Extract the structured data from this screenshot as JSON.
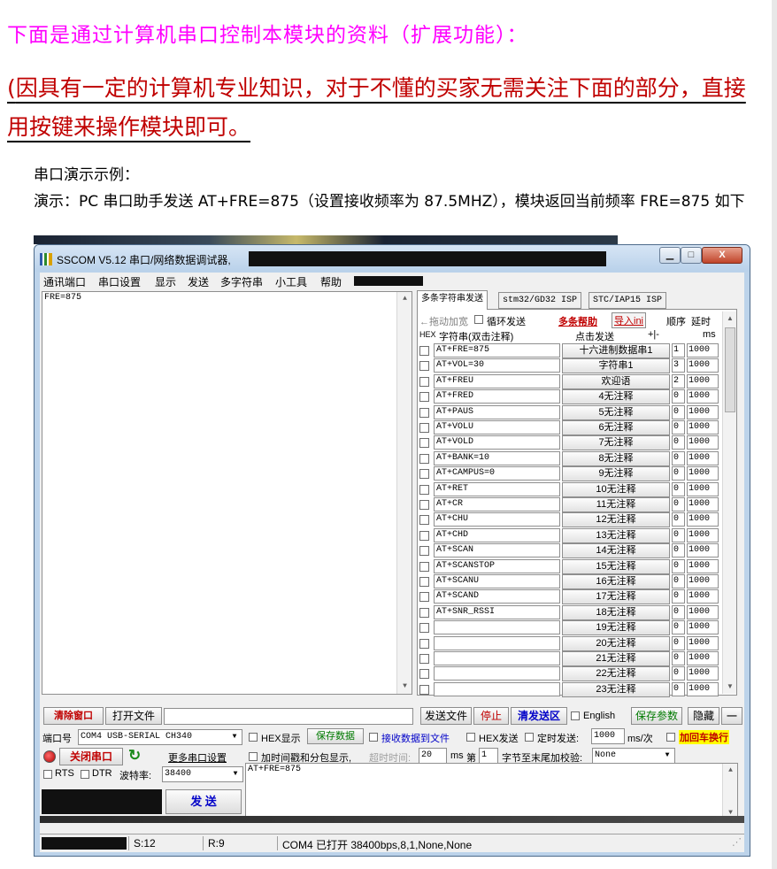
{
  "doc": {
    "heading": "下面是通过计算机串口控制本模块的资料（扩展功能）：",
    "note_open": "(",
    "note_text": "因具有一定的计算机专业知识，对于不懂的买家无需关注下面的部分，直接用按键来操作模块即可。",
    "demo_label": "串口演示示例：",
    "demo_line": "演示：PC 串口助手发送 AT+FRE=875（设置接收频率为 87.5MHZ），模块返回当前频率 FRE=875 如下"
  },
  "window": {
    "title": "SSCOM V5.12 串口/网络数据调试器,",
    "minimize": "▁",
    "maximize": "□",
    "close": "X"
  },
  "menu": [
    "通讯端口",
    "串口设置",
    "显示",
    "发送",
    "多字符串",
    "小工具",
    "帮助"
  ],
  "receive": {
    "text": "FRE=875"
  },
  "tabs": [
    "多条字符串发送",
    "stm32/GD32 ISP",
    "STC/IAP15 ISP"
  ],
  "panel": {
    "drag_hint": "←拖动加宽",
    "loop_send": "循环发送",
    "help": "多条帮助",
    "import": "导入ini",
    "order": "顺序",
    "delay": "延时",
    "hdr_hex": "HEX",
    "hdr_str": "字符串(双击注释)",
    "hdr_click": "点击发送",
    "hdr_pm": "+|-",
    "hdr_ms": "ms",
    "rows": [
      {
        "cmd": "AT+FRE=875",
        "label": "十六进制数据串1",
        "order": "1",
        "delay": "1000"
      },
      {
        "cmd": "AT+VOL=30",
        "label": "字符串1",
        "order": "3",
        "delay": "1000"
      },
      {
        "cmd": "AT+FREU",
        "label": "欢迎语",
        "order": "2",
        "delay": "1000"
      },
      {
        "cmd": "AT+FRED",
        "label": "4无注释",
        "order": "0",
        "delay": "1000"
      },
      {
        "cmd": "AT+PAUS",
        "label": "5无注释",
        "order": "0",
        "delay": "1000"
      },
      {
        "cmd": "AT+VOLU",
        "label": "6无注释",
        "order": "0",
        "delay": "1000"
      },
      {
        "cmd": "AT+VOLD",
        "label": "7无注释",
        "order": "0",
        "delay": "1000"
      },
      {
        "cmd": "AT+BANK=10",
        "label": "8无注释",
        "order": "0",
        "delay": "1000"
      },
      {
        "cmd": "AT+CAMPUS=0",
        "label": "9无注释",
        "order": "0",
        "delay": "1000"
      },
      {
        "cmd": "AT+RET",
        "label": "10无注释",
        "order": "0",
        "delay": "1000"
      },
      {
        "cmd": "AT+CR",
        "label": "11无注释",
        "order": "0",
        "delay": "1000"
      },
      {
        "cmd": "AT+CHU",
        "label": "12无注释",
        "order": "0",
        "delay": "1000"
      },
      {
        "cmd": "AT+CHD",
        "label": "13无注释",
        "order": "0",
        "delay": "1000"
      },
      {
        "cmd": "AT+SCAN",
        "label": "14无注释",
        "order": "0",
        "delay": "1000"
      },
      {
        "cmd": "AT+SCANSTOP",
        "label": "15无注释",
        "order": "0",
        "delay": "1000"
      },
      {
        "cmd": "AT+SCANU",
        "label": "16无注释",
        "order": "0",
        "delay": "1000"
      },
      {
        "cmd": "AT+SCAND",
        "label": "17无注释",
        "order": "0",
        "delay": "1000"
      },
      {
        "cmd": "AT+SNR_RSSI",
        "label": "18无注释",
        "order": "0",
        "delay": "1000"
      },
      {
        "cmd": "",
        "label": "19无注释",
        "order": "0",
        "delay": "1000"
      },
      {
        "cmd": "",
        "label": "20无注释",
        "order": "0",
        "delay": "1000"
      },
      {
        "cmd": "",
        "label": "21无注释",
        "order": "0",
        "delay": "1000"
      },
      {
        "cmd": "",
        "label": "22无注释",
        "order": "0",
        "delay": "1000"
      },
      {
        "cmd": "",
        "label": "23无注释",
        "order": "0",
        "delay": "1000"
      }
    ]
  },
  "toolbar": {
    "clear": "清除窗口",
    "open_file": "打开文件",
    "send_file": "发送文件",
    "stop": "停止",
    "clear_send": "清发送区",
    "english": "English",
    "save_params": "保存参数",
    "hide": "隐藏",
    "dash": "—"
  },
  "controls": {
    "port_label": "端口号",
    "port_value": "COM4 USB-SERIAL CH340",
    "hex_show": "HEX显示",
    "save_data": "保存数据",
    "recv_to_file": "接收数据到文件",
    "hex_send": "HEX发送",
    "timed_send": "定时发送:",
    "timed_value": "1000",
    "per": "ms/次",
    "append_crlf": "加回车换行",
    "close_port": "关闭串口",
    "more_ports": "更多串口设置",
    "timestamp": "加时间戳和分包显示,",
    "timeout_label": "超时时间:",
    "timeout_value": "20",
    "ms": "ms",
    "di": "第",
    "byte_value": "1",
    "checksum_label": "字节至末尾加校验:",
    "checksum_value": "None",
    "rts": "RTS",
    "dtr": "DTR",
    "baud_label": "波特率:",
    "baud_value": "38400",
    "send": "发 送",
    "send_text": "AT+FRE=875"
  },
  "status": {
    "s": "S:12",
    "r": "R:9",
    "port": "COM4 已打开  38400bps,8,1,None,None"
  },
  "colors": {
    "magenta": "#ff00ff",
    "red": "#c00000",
    "green": "#007a00",
    "blue": "#0000c8"
  }
}
